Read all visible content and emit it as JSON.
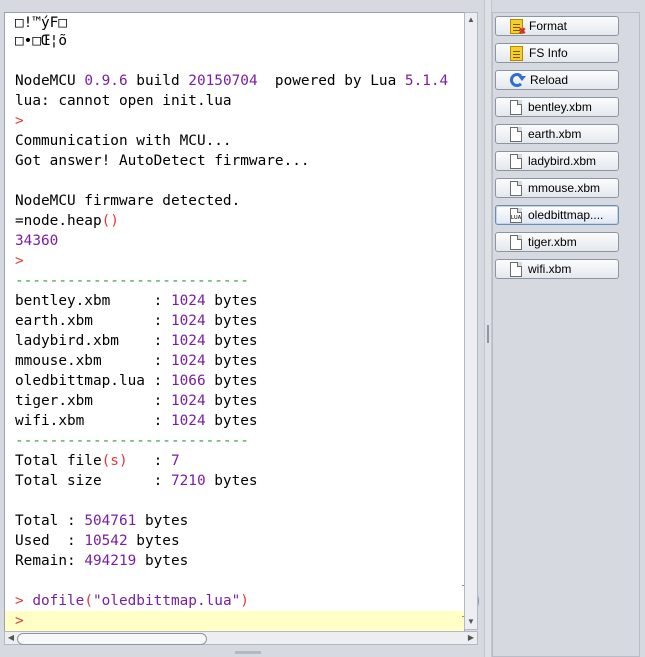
{
  "terminal": {
    "lines": {
      "l1": "□!™ýF□",
      "l2": "□•□Œ¦õ",
      "l3a": "NodeMCU ",
      "l3b": "0.9.6",
      "l3c": " build ",
      "l3d": "20150704",
      "l3e": "  powered by Lua ",
      "l3f": "5.1.4",
      "l4": "lua: cannot open init.lua",
      "l5": ">",
      "l6": "Communication with MCU...",
      "l7": "Got answer! AutoDetect firmware...",
      "l8": "NodeMCU firmware detected.",
      "l9a": "=node.heap",
      "l9b": "()",
      "l10": "34360",
      "l11": ">",
      "sep": "---------------------------",
      "files": [
        {
          "name": "bentley.xbm     : ",
          "size": "1024",
          "unit": " bytes"
        },
        {
          "name": "earth.xbm       : ",
          "size": "1024",
          "unit": " bytes"
        },
        {
          "name": "ladybird.xbm    : ",
          "size": "1024",
          "unit": " bytes"
        },
        {
          "name": "mmouse.xbm      : ",
          "size": "1024",
          "unit": " bytes"
        },
        {
          "name": "oledbittmap.lua : ",
          "size": "1066",
          "unit": " bytes"
        },
        {
          "name": "tiger.xbm       : ",
          "size": "1024",
          "unit": " bytes"
        },
        {
          "name": "wifi.xbm        : ",
          "size": "1024",
          "unit": " bytes"
        }
      ],
      "tf_a": "Total file",
      "tf_b": "(s)",
      "tf_c": "   : ",
      "tf_d": "7",
      "ts_a": "Total size      : ",
      "ts_b": "7210",
      "ts_c": " bytes",
      "tot_a": "Total : ",
      "tot_b": "504761",
      "tot_c": " bytes",
      "used_a": "Used  : ",
      "used_b": "10542",
      "used_c": " bytes",
      "rem_a": "Remain: ",
      "rem_b": "494219",
      "rem_c": " bytes",
      "cmd_a": "> ",
      "cmd_b": "dofile",
      "cmd_c": "(",
      "cmd_d": "\"oledbittmap.lua\"",
      "cmd_e": ")",
      "prompt": ">"
    }
  },
  "right_panel": {
    "buttons": [
      {
        "label": "Format",
        "icon": "format-icon"
      },
      {
        "label": "FS Info",
        "icon": "fs-info-icon"
      },
      {
        "label": "Reload",
        "icon": "reload-icon"
      },
      {
        "label": "bentley.xbm",
        "icon": "file-icon"
      },
      {
        "label": "earth.xbm",
        "icon": "file-icon"
      },
      {
        "label": "ladybird.xbm",
        "icon": "file-icon"
      },
      {
        "label": "mmouse.xbm",
        "icon": "file-icon"
      },
      {
        "label": "oledbittmap....",
        "icon": "lua-file-icon",
        "icon_text": "LUA"
      },
      {
        "label": "tiger.xbm",
        "icon": "file-icon"
      },
      {
        "label": "wifi.xbm",
        "icon": "file-icon"
      }
    ]
  },
  "colors": {
    "number": "#7a1fa2",
    "bracket": "#e53935",
    "separator": "#2e9e2e",
    "prompt_line_bg": "#ffffc6"
  }
}
